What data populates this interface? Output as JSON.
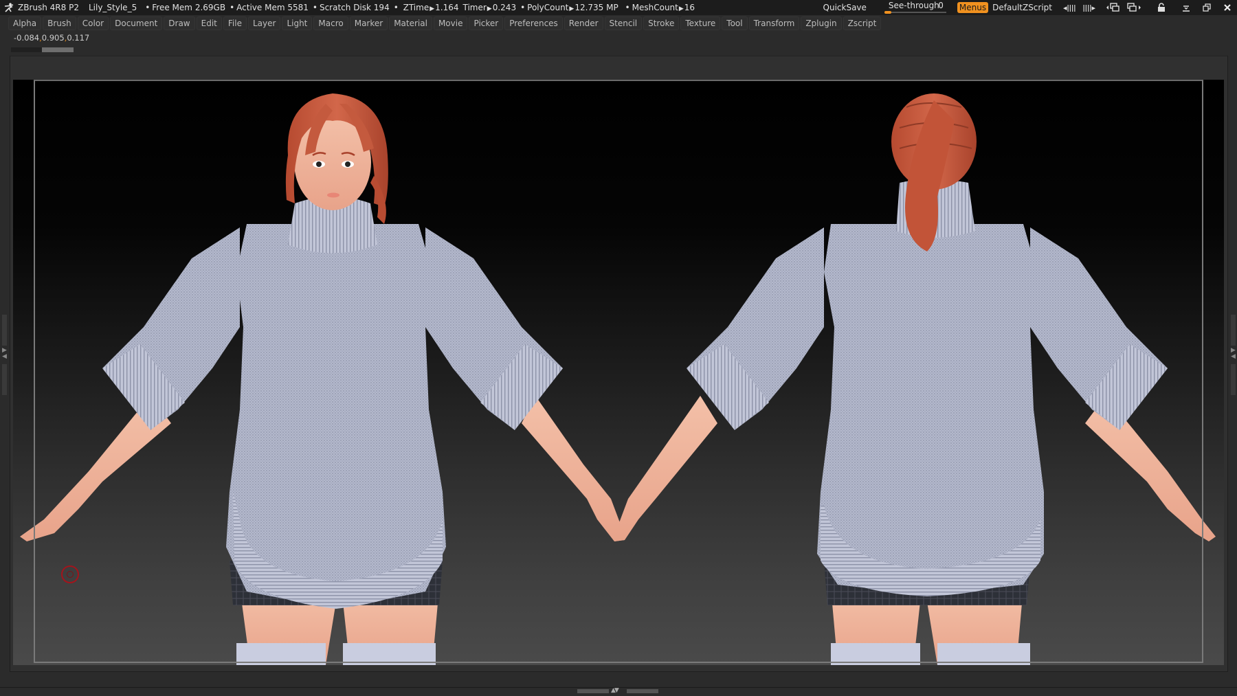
{
  "titlebar": {
    "app_title": "ZBrush 4R8 P2",
    "document_name": "Lily_Style_5",
    "stats": [
      {
        "label": "Free Mem",
        "value": "2.69GB"
      },
      {
        "label": "Active Mem",
        "value": "5581"
      },
      {
        "label": "Scratch Disk",
        "value": "194"
      }
    ],
    "ztime": {
      "label": "ZTime",
      "value": "1.164"
    },
    "timer": {
      "label": "Timer",
      "value": "0.243"
    },
    "polycount": {
      "label": "PolyCount",
      "value": "12.735 MP"
    },
    "meshcount": {
      "label": "MeshCount",
      "value": "16"
    },
    "quicksave_label": "QuickSave",
    "seethrough": {
      "label": "See-through",
      "value": "0",
      "fraction": 0
    },
    "menus_label": "Menus",
    "zscript_label": "DefaultZScript",
    "icons": [
      "tray-shrink-icon",
      "tray-expand-icon",
      "window-prev-icon",
      "window-next-icon",
      "lock-icon",
      "minimize-icon",
      "restore-icon",
      "close-icon"
    ]
  },
  "menubar": {
    "items": [
      "Alpha",
      "Brush",
      "Color",
      "Document",
      "Draw",
      "Edit",
      "File",
      "Layer",
      "Light",
      "Macro",
      "Marker",
      "Material",
      "Movie",
      "Picker",
      "Preferences",
      "Render",
      "Stencil",
      "Stroke",
      "Texture",
      "Tool",
      "Transform",
      "Zplugin",
      "Zscript"
    ]
  },
  "coords": {
    "x": "-0.084",
    "y": "0.905",
    "z": "0.117"
  },
  "colors": {
    "accent": "#f0911f",
    "sweater": "#b7bccf",
    "hair": "#c4563a",
    "skin": "#f2b49c",
    "brush_cursor": "#a3141c"
  },
  "canvas": {
    "figures": [
      {
        "view": "front",
        "description": "character in turtleneck sweater, front view"
      },
      {
        "view": "back",
        "description": "character in turtleneck sweater, back view"
      }
    ]
  }
}
